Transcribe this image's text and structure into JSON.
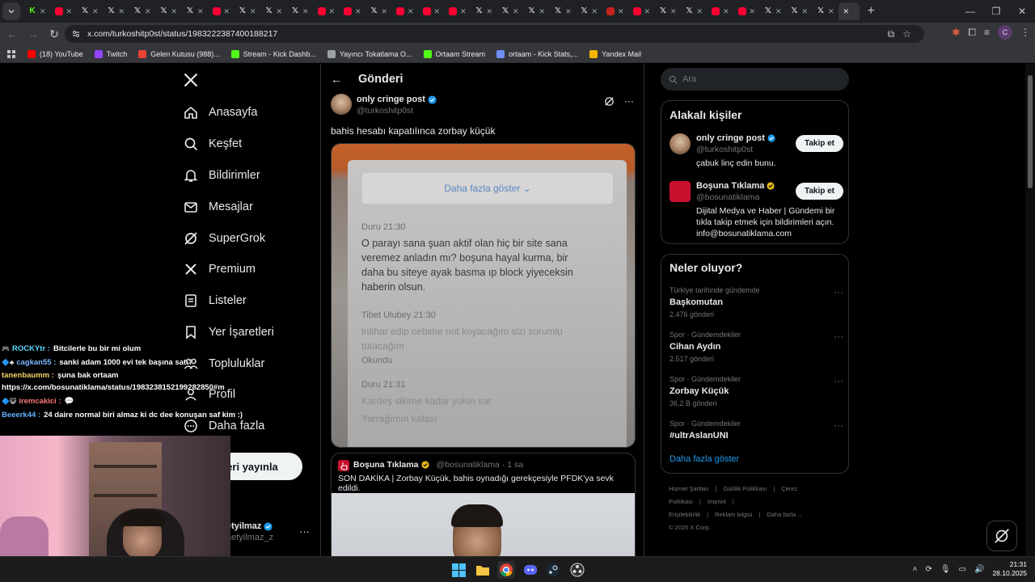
{
  "browser": {
    "url": "x.com/turkoshitp0st/status/1983222387400188217",
    "bookmarks": [
      {
        "label": "(18) YouTube",
        "icon": "youtube-icon",
        "color": "#ff0000"
      },
      {
        "label": "Twitch",
        "icon": "twitch-icon",
        "color": "#9146ff"
      },
      {
        "label": "Gelen Kutusu (988)...",
        "icon": "gmail-icon",
        "color": "#ea4335"
      },
      {
        "label": "Stream - Kick Dashb...",
        "icon": "kick-icon",
        "color": "#53fc18"
      },
      {
        "label": "Yayıncı Tokatlama O...",
        "icon": "globe-icon",
        "color": "#9aa0a6"
      },
      {
        "label": "Ortaam Stream",
        "icon": "kick-icon",
        "color": "#53fc18"
      },
      {
        "label": "ortaam - Kick Stats,...",
        "icon": "stats-icon",
        "color": "#6c8ef5"
      },
      {
        "label": "Yandex Mail",
        "icon": "mail-icon",
        "color": "#f4b400"
      }
    ]
  },
  "nav": {
    "items": [
      {
        "label": "Anasayfa",
        "icon": "home-icon"
      },
      {
        "label": "Keşfet",
        "icon": "search-icon"
      },
      {
        "label": "Bildirimler",
        "icon": "bell-icon"
      },
      {
        "label": "Mesajlar",
        "icon": "mail-icon"
      },
      {
        "label": "SuperGrok",
        "icon": "grok-icon"
      },
      {
        "label": "Premium",
        "icon": "x-logo-icon"
      },
      {
        "label": "Listeler",
        "icon": "list-icon"
      },
      {
        "label": "Yer İşaretleri",
        "icon": "bookmark-icon"
      },
      {
        "label": "Topluluklar",
        "icon": "people-icon"
      },
      {
        "label": "Profil",
        "icon": "person-icon"
      },
      {
        "label": "Daha fazla",
        "icon": "more-circle-icon"
      }
    ],
    "post_button": "eri yayınla",
    "account_name": "etyilmaz",
    "account_handle": "netyilmaz_z"
  },
  "post": {
    "header_title": "Gönderi",
    "author_name": "only cringe post",
    "author_handle": "@turkoshitp0st",
    "text": "bahis hesabı kapatılınca zorbay küçük",
    "media": {
      "banner": "Daha fazla göster ⌄",
      "lines": [
        {
          "text": "Duru 21:30",
          "kind": "h"
        },
        {
          "text": "O parayı sana şuan aktif olan hiç bir site sana",
          "kind": "m"
        },
        {
          "text": "veremez anladın mı? boşuna hayal kurma, bir",
          "kind": "m"
        },
        {
          "text": "daha bu siteye ayak basma ıp block yiyeceksin",
          "kind": "m"
        },
        {
          "text": "haberin olsun.",
          "kind": "m"
        },
        {
          "text": "Tibet Ulubey 21:30",
          "kind": "h"
        },
        {
          "text": "intihar edip cebime not koyacağım sizi sorumlu",
          "kind": "f"
        },
        {
          "text": "tutacağım",
          "kind": "f"
        },
        {
          "text": "Okundu",
          "kind": "h"
        },
        {
          "text": "Duru 21:31",
          "kind": "h"
        },
        {
          "text": "Kardeş sikime kadar yolun var",
          "kind": "f"
        },
        {
          "text": "Yarrağımın kafası",
          "kind": "f"
        }
      ]
    },
    "quote": {
      "author_name": "Boşuna Tıklama",
      "author_meta": "@bosunatiklama · 1 sa",
      "text": "SON DAKİKA |  Zorbay Küçük, bahis oynadığı gerekçesiyle PFDK'ya sevk edildi."
    }
  },
  "sidebar": {
    "search_placeholder": "Ara",
    "relevant_title": "Alakalı kişiler",
    "people": [
      {
        "name": "only cringe post",
        "handle": "@turkoshitp0st",
        "bio": "çabuk linç edin bunu.",
        "follow": "Takip et",
        "verified": "blue"
      },
      {
        "name": "Boşuna Tıklama",
        "handle": "@bosunatiklama",
        "bio": "Dijital Medya ve Haber | Gündemi bir tıkla takip etmek için bildirimleri açın. info@bosunatiklama.com",
        "follow": "Takip et",
        "verified": "gold"
      }
    ],
    "trends_title": "Neler oluyor?",
    "trends": [
      {
        "context": "Türkiye tarihinde gündemde",
        "name": "Başkomutan",
        "count": "2.476 gönderi"
      },
      {
        "context": "Spor · Gündemdekiler",
        "name": "Cihan Aydın",
        "count": "2.517 gönderi"
      },
      {
        "context": "Spor · Gündemdekiler",
        "name": "Zorbay Küçük",
        "count": "36,2 B gönderi"
      },
      {
        "context": "Spor · Gündemdekiler",
        "name": "#ultrAslanUNI",
        "count": ""
      }
    ],
    "show_more": "Daha fazla göster",
    "footer": [
      "Hizmet Şartları",
      "|",
      "Gizlilik Politikası",
      "|",
      "Çerez Politikası",
      "|",
      "Imprint",
      "|",
      "Erişilebilirlik",
      "|",
      "Reklam bilgisi",
      "|",
      "Daha fazla ...",
      "© 2025 X Corp."
    ]
  },
  "chat": [
    {
      "user": "ROCKYtr :",
      "msg": "Bitcilerle bu bir mi olum",
      "color": "#5ad7ff",
      "badge": "🎮"
    },
    {
      "user": "cagkan55 :",
      "msg": "sanki adam 1000 evi tek başına satı?",
      "color": "#7ab8ff",
      "badge": "🔷♣"
    },
    {
      "user": "tanenbaumm :",
      "msg": "şuna bak ortaam",
      "color": "#f5d36b",
      "badge": ""
    },
    {
      "user": "",
      "msg": "https://x.com/bosunatiklama/status/1983238152199282850#m",
      "color": "#ffffff",
      "badge": ""
    },
    {
      "user": "iremcakici :",
      "msg": "💬",
      "color": "#ff7a7a",
      "badge": "🔷😺"
    },
    {
      "user": "Beeerk44 :",
      "msg": "24 daire normal biri almaz ki dc dee konuşan saf kim :)",
      "color": "#62b1ff",
      "badge": ""
    }
  ],
  "taskbar": {
    "time": "21:31",
    "date": "28.10.2025"
  }
}
